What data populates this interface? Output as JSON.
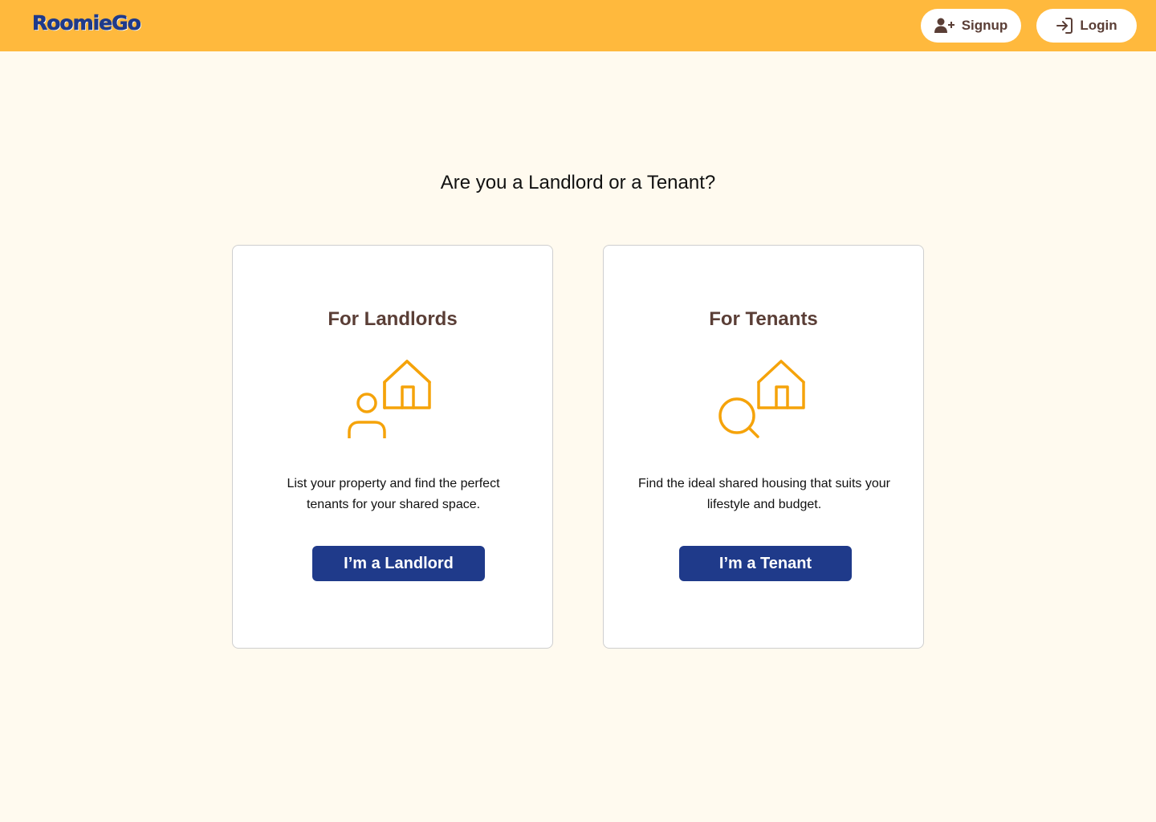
{
  "header": {
    "logo_text": "RoomieGo",
    "signup_label": "Signup",
    "signup_icon": "user-plus-icon",
    "login_label": "Login",
    "login_icon": "login-icon"
  },
  "main": {
    "question": "Are you a Landlord or a Tenant?",
    "cards": [
      {
        "title": "For Landlords",
        "icon": "landlord-house-icon",
        "description": "List your property and find the perfect tenants for your shared space.",
        "button_label": "I’m a Landlord"
      },
      {
        "title": "For Tenants",
        "icon": "tenant-search-house-icon",
        "description": "Find the ideal shared housing that suits your lifestyle and budget.",
        "button_label": "I’m a Tenant"
      }
    ]
  },
  "colors": {
    "header_bg": "#FFB93D",
    "page_bg": "#FFFAEF",
    "brand_blue": "#1F3A8A",
    "accent_brown": "#5A3E36",
    "icon_orange": "#F5A30A"
  }
}
